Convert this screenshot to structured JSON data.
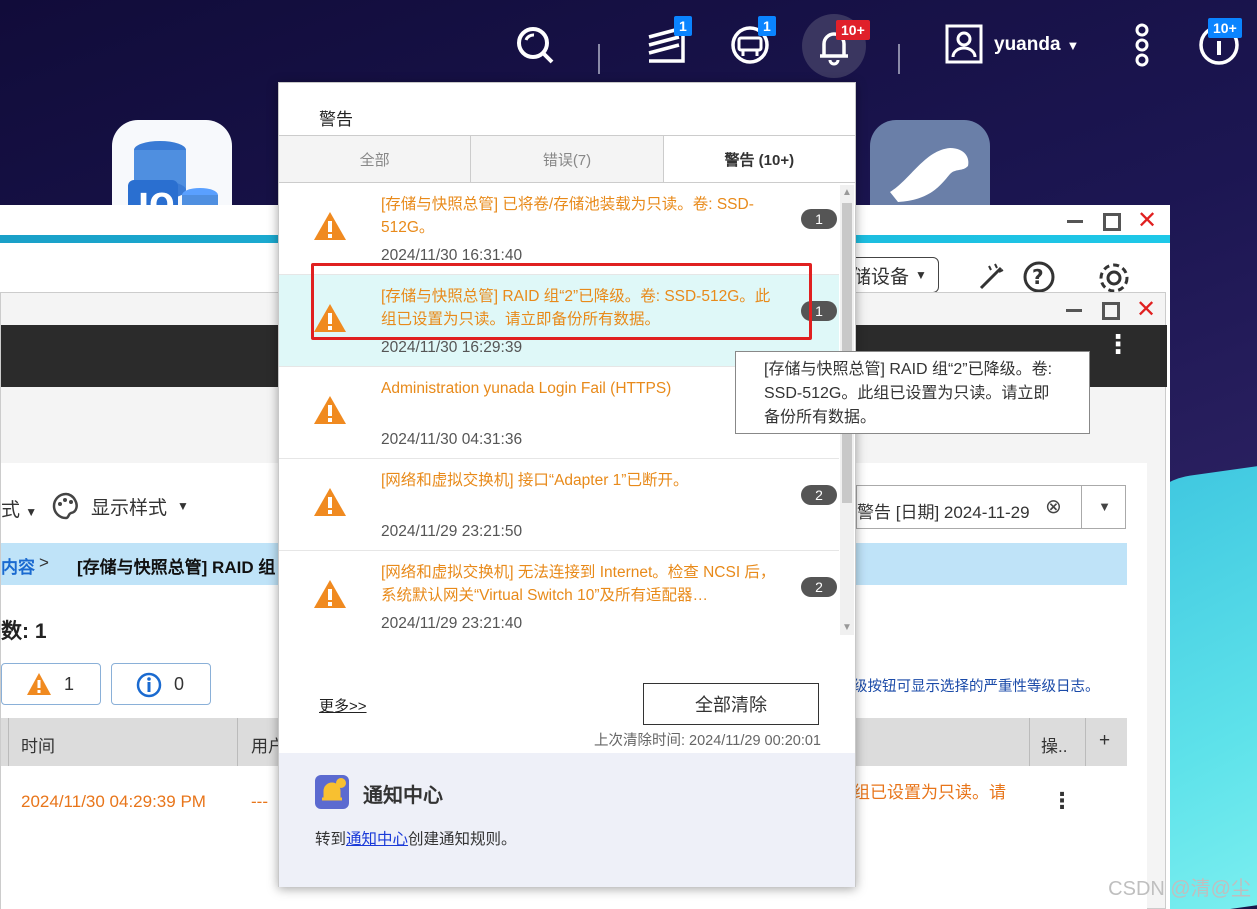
{
  "topbar": {
    "badges": {
      "tasks": "1",
      "sync": "1",
      "notifications": "10+",
      "info": "10+"
    },
    "user": "yuanda"
  },
  "bg_window": {
    "toolbar_dropdown": "储设备",
    "menu_items": [
      "式",
      "显示样式"
    ],
    "breadcrumb_left": "内容",
    "breadcrumb_sep": ">",
    "breadcrumb_text": "[存储与快照总管] RAID 组",
    "count_label": "数: 1",
    "warn_count": "1",
    "info_count": "0",
    "filter_text": "警告 [日期] 2024-11-29",
    "hint": "级按钮可显示选择的严重性等级日志。",
    "table_headers": {
      "time": "时间",
      "user": "用户",
      "action": "操..",
      "add": "+"
    },
    "row": {
      "time": "2024/11/30 04:29:39 PM",
      "user": "---",
      "msg": "组已设置为只读。请"
    }
  },
  "panel": {
    "title": "警告",
    "tabs": [
      "全部",
      "错误(7)",
      "警告 (10+)"
    ],
    "items": [
      {
        "msg": "[存储与快照总管] 已将卷/存储池装载为只读。卷: SSD-512G。",
        "time": "2024/11/30 16:31:40",
        "count": "1"
      },
      {
        "msg": "[存储与快照总管] RAID 组“2”已降级。卷: SSD-512G。此组已设置为只读。请立即备份所有数据。",
        "time": "2024/11/30 16:29:39",
        "count": "1"
      },
      {
        "msg": "Administration yunada Login Fail (HTTPS)",
        "time": "2024/11/30 04:31:36",
        "count": ""
      },
      {
        "msg": "[网络和虚拟交换机] 接口“Adapter 1”已断开。",
        "time": "2024/11/29 23:21:50",
        "count": "2"
      },
      {
        "msg": "[网络和虚拟交换机] 无法连接到 Internet。检查 NCSI 后，系统默认网关“Virtual Switch 10”及所有适配器…",
        "time": "2024/11/29 23:21:40",
        "count": "2"
      }
    ],
    "more": "更多>>",
    "clear_all": "全部清除",
    "last_clear": "上次清除时间: 2024/11/29 00:20:01",
    "nc_title": "通知中心",
    "nc_prefix": "转到",
    "nc_link": "通知中心",
    "nc_suffix": "创建通知规则。"
  },
  "tooltip": "[存储与快照总管] RAID 组“2”已降级。卷: SSD-512G。此组已设置为只读。请立即备份所有数据。",
  "watermark": "CSDN @清@尘",
  "colors": {
    "warning": "#e88a1a",
    "highlight": "#dff8f8",
    "accent": "#0a84ff",
    "alert_box": "#e02020"
  }
}
